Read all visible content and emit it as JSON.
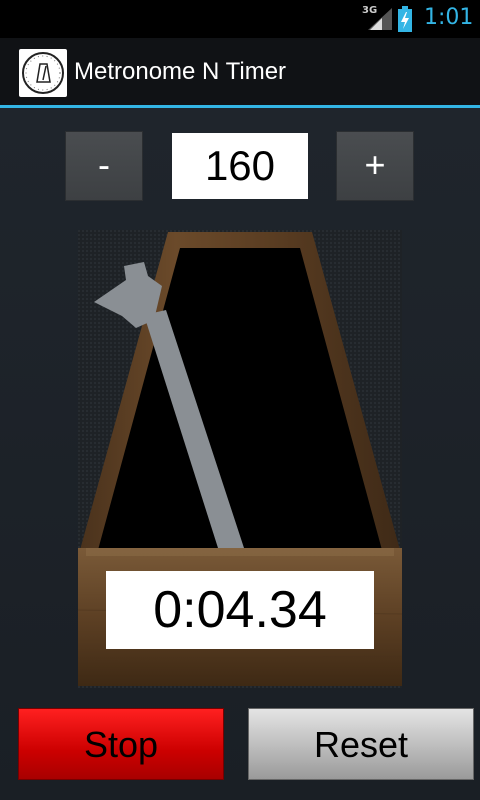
{
  "status_bar": {
    "network": "3G",
    "time": "1:01",
    "signal_icon": "signal-bars-icon",
    "battery_icon": "battery-charging-icon"
  },
  "action_bar": {
    "title": "Metronome N Timer",
    "icon": "metronome-clock-icon"
  },
  "tempo": {
    "decrement_label": "-",
    "value": "160",
    "increment_label": "+"
  },
  "timer": {
    "elapsed": "0:04.34"
  },
  "controls": {
    "stop_label": "Stop",
    "reset_label": "Reset"
  },
  "colors": {
    "accent": "#33b5e5",
    "stop_button": "#e00000",
    "reset_button": "#c8c8c8",
    "wood": "#5a3d22"
  }
}
